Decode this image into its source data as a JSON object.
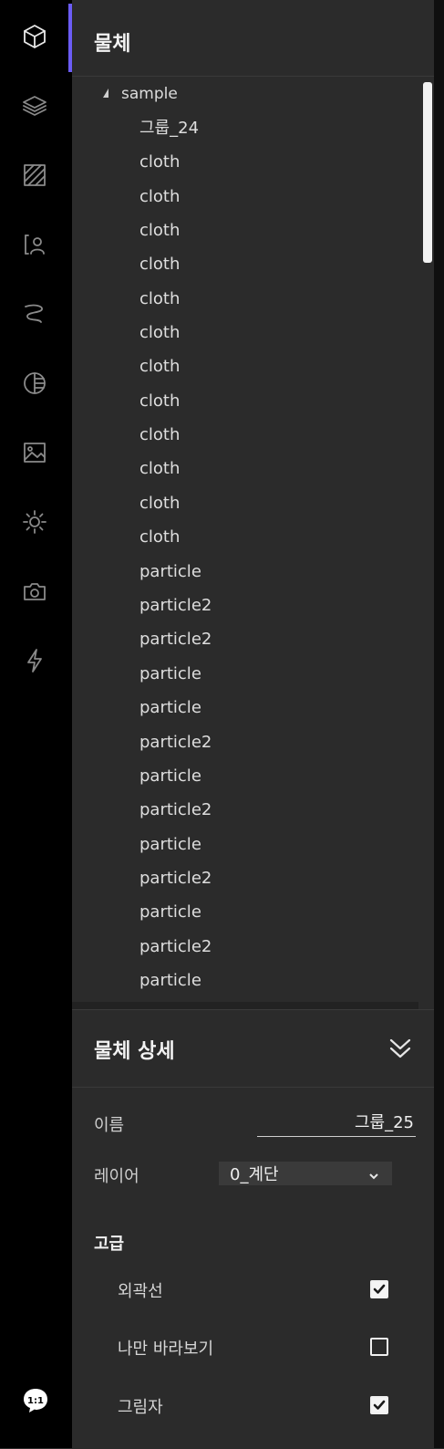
{
  "rail": {
    "icons": [
      "cube-icon",
      "layers-icon",
      "hatch-pattern-icon",
      "person-icon",
      "curve-icon",
      "half-sphere-icon",
      "image-icon",
      "sun-icon",
      "camera-icon",
      "lightning-icon"
    ],
    "ratio_badge": "1:1"
  },
  "colors": {
    "accent": "#6b5cf5",
    "panel_bg": "#2b2b2b",
    "rail_bg": "#000000"
  },
  "panel": {
    "title": "물체",
    "tree": {
      "root": "sample",
      "items": [
        "그룹_24",
        "cloth",
        "cloth",
        "cloth",
        "cloth",
        "cloth",
        "cloth",
        "cloth",
        "cloth",
        "cloth",
        "cloth",
        "cloth",
        "cloth",
        "particle",
        "particle2",
        "particle2",
        "particle",
        "particle",
        "particle2",
        "particle",
        "particle2",
        "particle",
        "particle2",
        "particle",
        "particle2",
        "particle"
      ]
    }
  },
  "details": {
    "title": "물체 상세",
    "name_label": "이름",
    "name_value": "그룹_25",
    "layer_label": "레이어",
    "layer_value": "0_계단",
    "advanced_title": "고급",
    "options": [
      {
        "label": "외곽선",
        "checked": true
      },
      {
        "label": "나만 바라보기",
        "checked": false
      },
      {
        "label": "그림자",
        "checked": true
      }
    ]
  }
}
